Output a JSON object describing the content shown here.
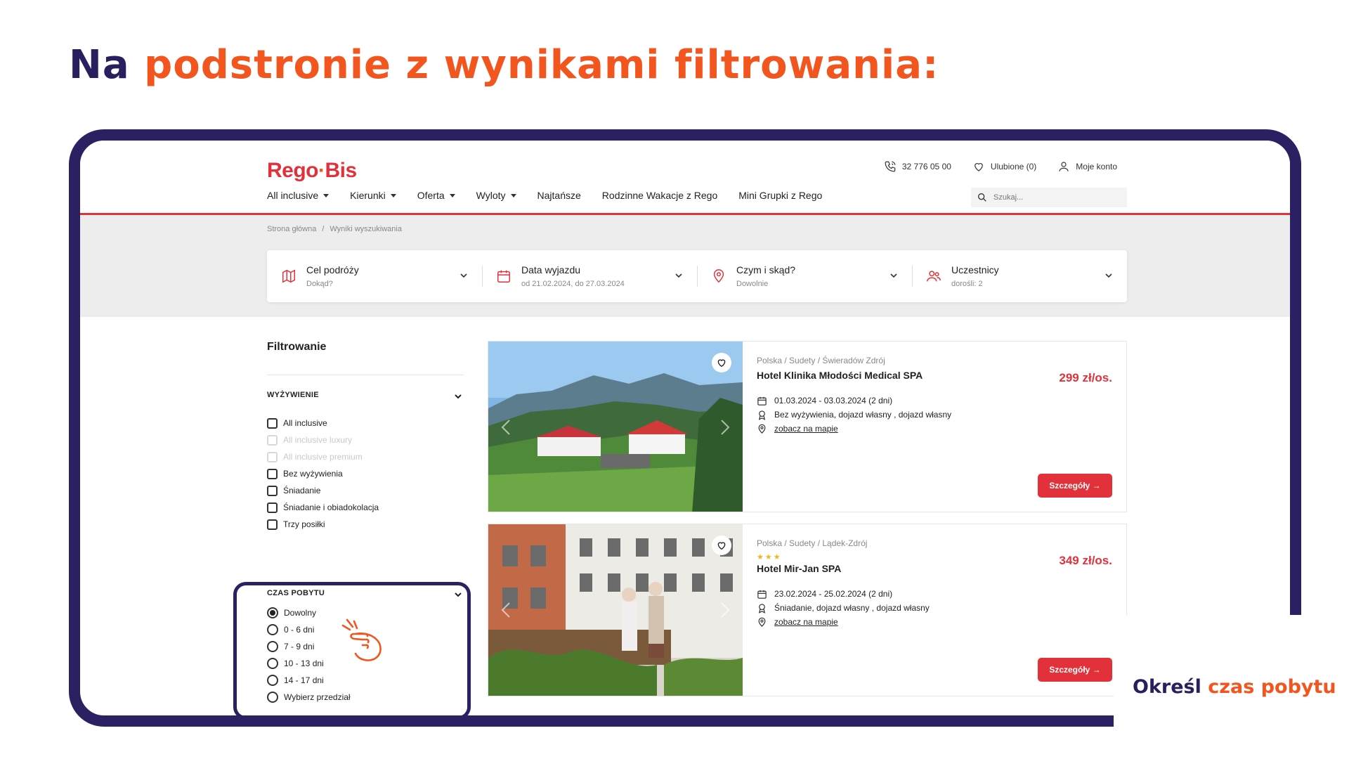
{
  "slide": {
    "title_part1": "Na",
    "title_part2": "podstronie z wynikami filtrowania:",
    "caption_part1": "Określ",
    "caption_part2": "czas pobytu"
  },
  "header": {
    "logo_part1": "Rego",
    "logo_dot": "·",
    "logo_part2": "Bis",
    "phone": "32 776 05 00",
    "favorites": "Ulubione (0)",
    "account": "Moje konto",
    "search_placeholder": "Szukaj..."
  },
  "nav": [
    {
      "label": "All inclusive",
      "dropdown": true
    },
    {
      "label": "Kierunki",
      "dropdown": true
    },
    {
      "label": "Oferta",
      "dropdown": true
    },
    {
      "label": "Wyloty",
      "dropdown": true
    },
    {
      "label": "Najtańsze",
      "dropdown": false
    },
    {
      "label": "Rodzinne Wakacje z Rego",
      "dropdown": false
    },
    {
      "label": "Mini Grupki z Rego",
      "dropdown": false
    }
  ],
  "breadcrumb": {
    "home": "Strona główna",
    "separator": "/",
    "current": "Wyniki wyszukiwania"
  },
  "filterbar": [
    {
      "title": "Cel podróży",
      "value": "Dokąd?",
      "icon": "map-icon"
    },
    {
      "title": "Data wyjazdu",
      "value": "od 21.02.2024, do 27.03.2024",
      "icon": "calendar-icon"
    },
    {
      "title": "Czym i skąd?",
      "value": "Dowolnie",
      "icon": "location-pin-icon"
    },
    {
      "title": "Uczestnicy",
      "value": "dorośli: 2",
      "icon": "users-icon"
    }
  ],
  "sidebar": {
    "title": "Filtrowanie",
    "meal": {
      "heading": "WYŻYWIENIE",
      "options": [
        {
          "label": "All inclusive",
          "disabled": false
        },
        {
          "label": "All inclusive luxury",
          "disabled": true
        },
        {
          "label": "All inclusive premium",
          "disabled": true
        },
        {
          "label": "Bez wyżywienia",
          "disabled": false
        },
        {
          "label": "Śniadanie",
          "disabled": false
        },
        {
          "label": "Śniadanie i obiadokolacja",
          "disabled": false
        },
        {
          "label": "Trzy posiłki",
          "disabled": false
        }
      ]
    },
    "stay": {
      "heading": "CZAS POBYTU",
      "options": [
        {
          "label": "Dowolny",
          "selected": true
        },
        {
          "label": "0 - 6 dni",
          "selected": false
        },
        {
          "label": "7 - 9 dni",
          "selected": false
        },
        {
          "label": "10 - 13 dni",
          "selected": false
        },
        {
          "label": "14 - 17 dni",
          "selected": false
        },
        {
          "label": "Wybierz przedział",
          "selected": false
        }
      ]
    }
  },
  "results": [
    {
      "location": "Polska / Sudety / Świeradów Zdrój",
      "stars": "",
      "name": "Hotel Klinika Młodości Medical SPA",
      "price": "299 zł/os.",
      "dates": "01.03.2024 - 03.03.2024 (2 dni)",
      "board": "Bez wyżywienia, dojazd własny , dojazd własny",
      "map_link": "zobacz na mapie",
      "button": "Szczegóły →"
    },
    {
      "location": "Polska / Sudety / Lądek-Zdrój",
      "stars": "★★★",
      "name": "Hotel Mir-Jan SPA",
      "price": "349 zł/os.",
      "dates": "23.02.2024 - 25.02.2024 (2 dni)",
      "board": "Śniadanie, dojazd własny , dojazd własny",
      "map_link": "zobacz na mapie",
      "button": "Szczegóły →"
    }
  ],
  "colors": {
    "brand_red": "#e2313a",
    "accent_orange": "#f2551e",
    "frame_navy": "#2b2061",
    "star_yellow": "#f2b51e"
  }
}
